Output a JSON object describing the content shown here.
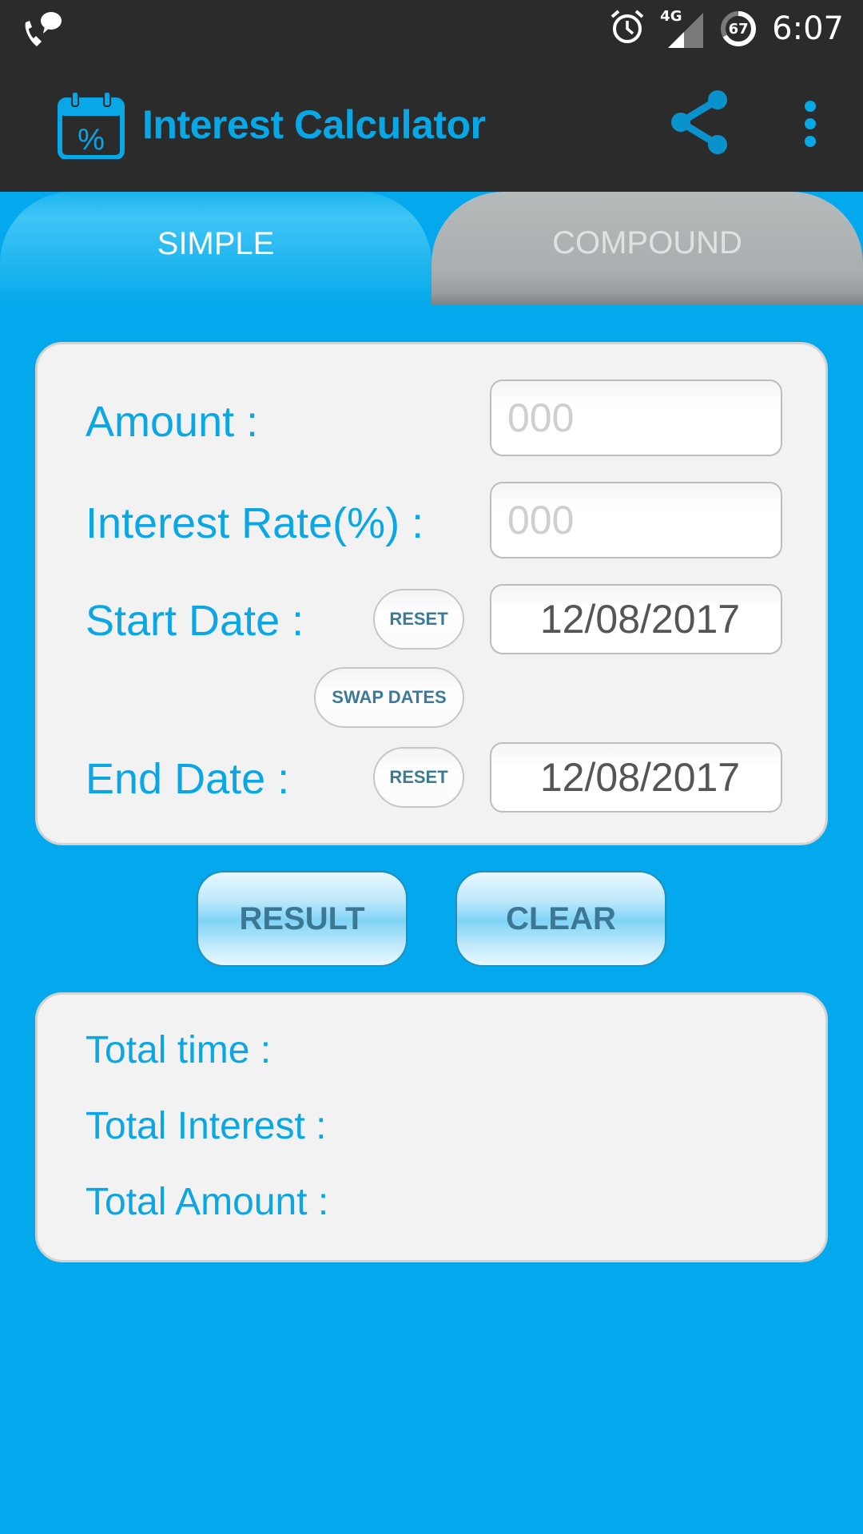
{
  "status_bar": {
    "time": "6:07",
    "network": "4G",
    "battery_level": "67",
    "icons": [
      "phone-chat-icon",
      "alarm-icon",
      "signal-icon",
      "battery-icon"
    ]
  },
  "app_bar": {
    "title": "Interest Calculator",
    "logo_icon": "calendar-percent-icon",
    "actions": [
      "share-icon",
      "more-vert-icon"
    ]
  },
  "tabs": [
    {
      "label": "SIMPLE",
      "active": true
    },
    {
      "label": "COMPOUND",
      "active": false
    }
  ],
  "form": {
    "amount_label": "Amount :",
    "amount_placeholder": "000",
    "amount_value": "",
    "rate_label": "Interest Rate(%) :",
    "rate_placeholder": "000",
    "rate_value": "",
    "start_date_label": "Start Date :",
    "start_date_value": "12/08/2017",
    "start_reset_label": "RESET",
    "swap_dates_label": "SWAP DATES",
    "end_date_label": "End Date :",
    "end_date_value": "12/08/2017",
    "end_reset_label": "RESET"
  },
  "actions": {
    "result_label": "RESULT",
    "clear_label": "CLEAR"
  },
  "results": {
    "total_time_label": "Total time :",
    "total_interest_label": "Total Interest :",
    "total_amount_label": "Total Amount :"
  },
  "colors": {
    "accent": "#03a9ec",
    "label_blue": "#0aa7e4",
    "app_bar_bg": "#2b2b2b",
    "button_text": "#3c7896"
  }
}
